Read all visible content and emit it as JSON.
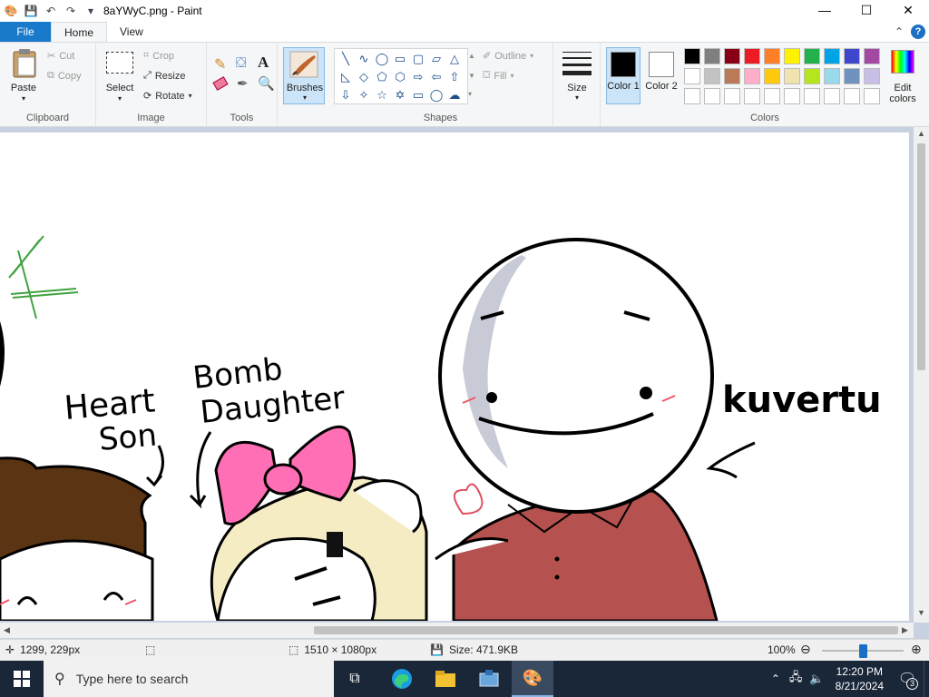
{
  "window": {
    "title": "8aYWyC.png - Paint",
    "controls": {
      "minimize": "—",
      "maximize": "☐",
      "close": "✕"
    }
  },
  "tabs": {
    "file": "File",
    "home": "Home",
    "view": "View"
  },
  "ribbon": {
    "clipboard": {
      "label": "Clipboard",
      "paste": "Paste",
      "cut": "Cut",
      "copy": "Copy"
    },
    "image": {
      "label": "Image",
      "select": "Select",
      "crop": "Crop",
      "resize": "Resize",
      "rotate": "Rotate"
    },
    "tools": {
      "label": "Tools",
      "text_glyph": "A"
    },
    "brushes": {
      "label": "Brushes"
    },
    "shapes": {
      "label": "Shapes",
      "outline": "Outline",
      "fill": "Fill",
      "glyphs": [
        "╲",
        "∿",
        "◯",
        "▭",
        "▢",
        "▱",
        "△",
        "◺",
        "◇",
        "⬠",
        "⬡",
        "⇨",
        "⇦",
        "⇧",
        "⇩",
        "✧",
        "☆",
        "✡",
        "▭",
        "◯",
        "☁"
      ]
    },
    "size": {
      "label": "Size"
    },
    "colors": {
      "label": "Colors",
      "color1": "Color 1",
      "color1_value": "#000000",
      "color2": "Color 2",
      "color2_value": "#ffffff",
      "edit": "Edit colors",
      "palette_row1": [
        "#000000",
        "#7f7f7f",
        "#880015",
        "#ed1c24",
        "#ff7f27",
        "#fff200",
        "#22b14c",
        "#00a2e8",
        "#3f48cc",
        "#a349a4"
      ],
      "palette_row2": [
        "#ffffff",
        "#c3c3c3",
        "#b97a57",
        "#ffaec9",
        "#ffc90e",
        "#efe4b0",
        "#b5e61d",
        "#99d9ea",
        "#7092be",
        "#c8bfe7"
      ]
    }
  },
  "canvas": {
    "texts": {
      "heart_son": [
        "Heart",
        "Son"
      ],
      "bomb_daughter": [
        "Bomb",
        "Daughter"
      ],
      "kuvertu": "kuvertu"
    }
  },
  "statusbar": {
    "cursor_pos": "1299, 229px",
    "dimensions": "1510 × 1080px",
    "size": "Size: 471.9KB",
    "zoom": "100%",
    "zoom_fraction": 0.5
  },
  "taskbar": {
    "search_placeholder": "Type here to search",
    "time": "12:20 PM",
    "date": "8/21/2024",
    "notifications": "3"
  }
}
